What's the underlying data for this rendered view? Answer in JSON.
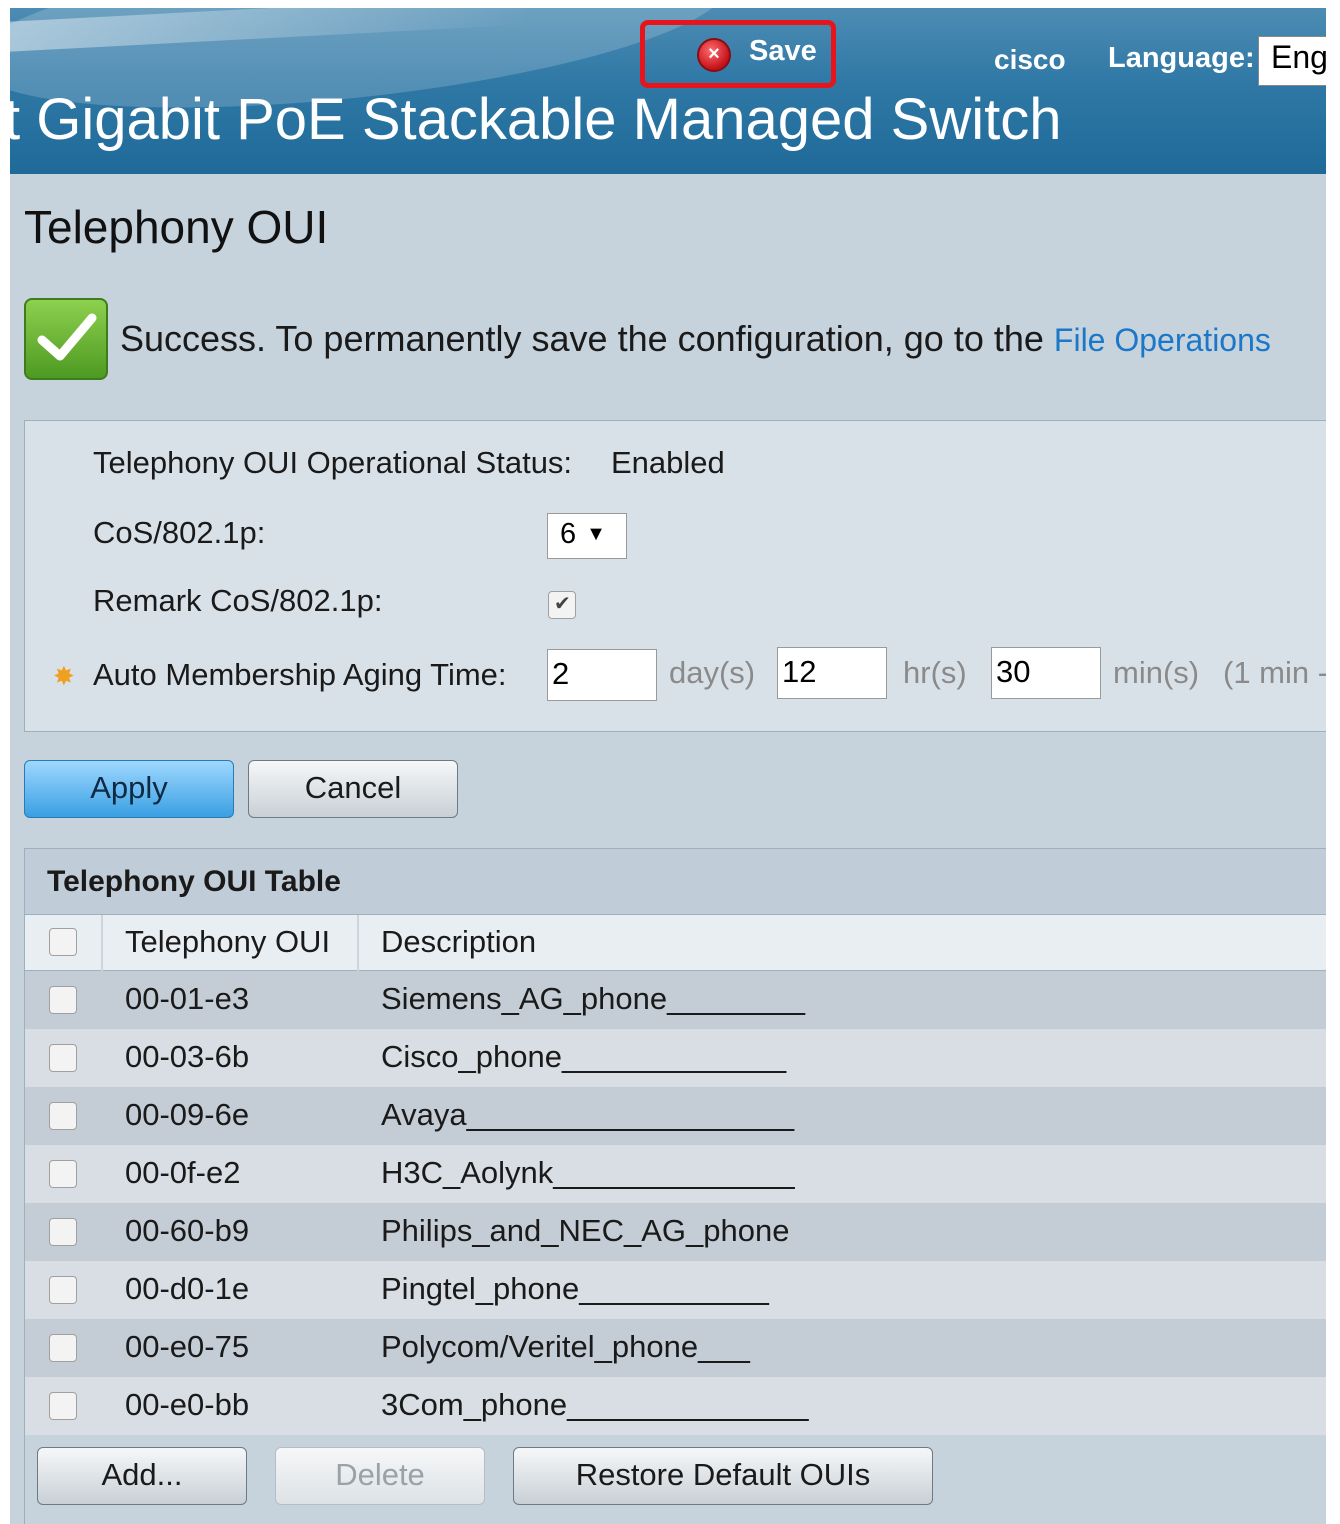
{
  "header": {
    "save_label": "Save",
    "brand": "cisco",
    "language_label": "Language:",
    "language_value": "Eng",
    "product_title": "t Gigabit PoE Stackable Managed Switch"
  },
  "page": {
    "title": "Telephony OUI",
    "success_message": "Success. To permanently save the configuration, go to the",
    "file_operations_link": "File Operations"
  },
  "settings": {
    "status_label": "Telephony OUI Operational Status:",
    "status_value": "Enabled",
    "cos_label": "CoS/802.1p:",
    "cos_value": "6",
    "remark_label": "Remark CoS/802.1p:",
    "remark_checked": true,
    "aging_label": "Auto Membership Aging Time:",
    "days_value": "2",
    "days_unit": "day(s)",
    "hours_value": "12",
    "hours_unit": "hr(s)",
    "minutes_value": "30",
    "minutes_unit": "min(s)",
    "range_hint": "(1 min -"
  },
  "actions": {
    "apply_label": "Apply",
    "cancel_label": "Cancel"
  },
  "table": {
    "caption": "Telephony OUI Table",
    "columns": [
      "Telephony OUI",
      "Description"
    ],
    "rows": [
      {
        "oui": "00-01-e3",
        "description": "Siemens_AG_phone________"
      },
      {
        "oui": "00-03-6b",
        "description": "Cisco_phone_____________"
      },
      {
        "oui": "00-09-6e",
        "description": "Avaya___________________"
      },
      {
        "oui": "00-0f-e2",
        "description": "H3C_Aolynk______________"
      },
      {
        "oui": "00-60-b9",
        "description": "Philips_and_NEC_AG_phone"
      },
      {
        "oui": "00-d0-1e",
        "description": "Pingtel_phone___________"
      },
      {
        "oui": "00-e0-75",
        "description": "Polycom/Veritel_phone___"
      },
      {
        "oui": "00-e0-bb",
        "description": "3Com_phone______________"
      }
    ],
    "add_label": "Add...",
    "delete_label": "Delete",
    "restore_label": "Restore Default OUIs"
  }
}
